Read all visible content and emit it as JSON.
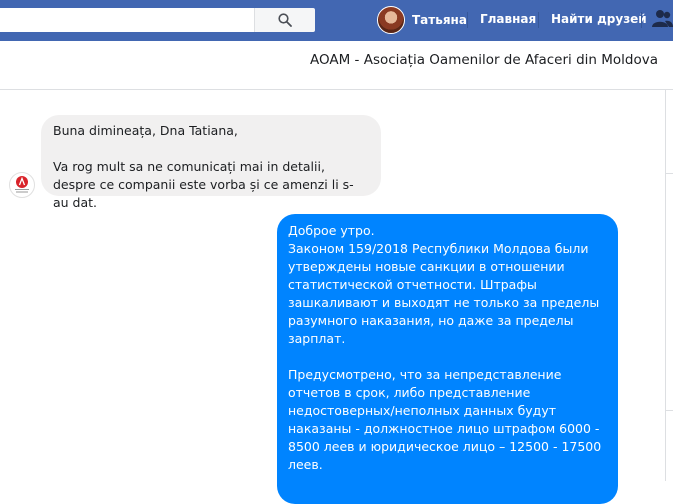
{
  "topbar": {
    "search_placeholder": "",
    "user_name": "Татьяна",
    "nav_home": "Главная",
    "nav_find_friends": "Найти друзей",
    "colors": {
      "bar": "#4267b2",
      "text": "#ffffff"
    }
  },
  "conversation": {
    "title": "AOAM - Asociația Oamenilor de Afaceri din Moldova"
  },
  "messages": [
    {
      "direction": "incoming",
      "text": "Buna dimineața, Dna Tatiana,\n\nVa rog mult sa ne comunicați mai in detalii, despre ce companii este vorba și ce amenzi li s-au dat."
    },
    {
      "direction": "outgoing",
      "text": "Доброе утро.\nЗаконом 159/2018 Республики Молдова были утверждены новые санкции в отношении статистической отчетности. Штрафы зашкаливают и выходят не только за пределы разумного наказания, но даже за пределы зарплат.\n\nПредусмотрено, что за непредставление отчетов в срок, либо представление недостоверных/неполных данных будут наказаны - должностное лицо штрафом 6000 - 8500 леев и юридическое лицо – 12500 - 17500 леев."
    }
  ],
  "icons": {
    "search": "search-icon",
    "friends": "friends-icon",
    "page_logo": "aoam-logo-icon"
  },
  "colors": {
    "incoming_bubble": "#f1f0f0",
    "outgoing_bubble": "#0084ff"
  }
}
